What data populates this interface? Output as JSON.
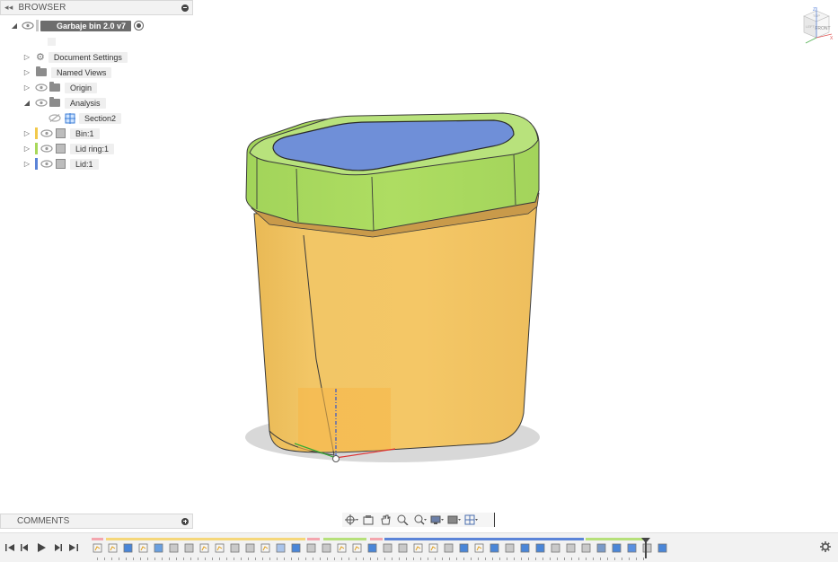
{
  "browser": {
    "title": "BROWSER",
    "root_label": "Garbaje bin 2.0 v7",
    "items": [
      {
        "label": "Document Settings",
        "icon": "gear-icon"
      },
      {
        "label": "Named Views",
        "icon": "folder-icon"
      },
      {
        "label": "Origin",
        "icon": "folder-icon"
      },
      {
        "label": "Analysis",
        "icon": "folder-icon"
      },
      {
        "label": "Section2",
        "icon": "section-analysis-icon"
      },
      {
        "label": "Bin:1",
        "icon": "body-icon",
        "color": "#f2c94c"
      },
      {
        "label": "Lid ring:1",
        "icon": "body-icon",
        "color": "#a8d85a"
      },
      {
        "label": "Lid:1",
        "icon": "body-icon",
        "color": "#5b84d8"
      }
    ]
  },
  "viewcube": {
    "top_label": "TOP",
    "front_label": "FRONT",
    "left_label": "LEFT",
    "z_axis": "Z",
    "x_axis": "X"
  },
  "comments": {
    "title": "COMMENTS"
  },
  "colors": {
    "bin": "#f2c25c",
    "lid_ring": "#a8d85a",
    "lid": "#6f8fd8",
    "timeline_pink": "#f4a6ae",
    "timeline_yellow": "#f5d77a",
    "timeline_green": "#b6e07a",
    "timeline_blue": "#5b84d8"
  }
}
